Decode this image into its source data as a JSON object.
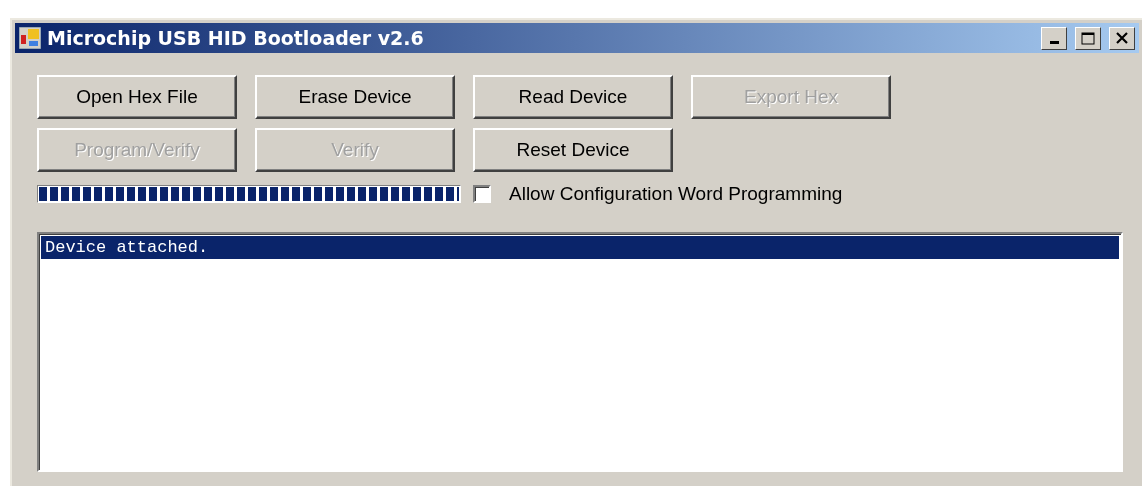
{
  "window": {
    "title": "Microchip USB HID Bootloader v2.6"
  },
  "buttons": [
    {
      "label": "Open Hex File",
      "disabled": false
    },
    {
      "label": "Erase Device",
      "disabled": false
    },
    {
      "label": "Read Device",
      "disabled": false
    },
    {
      "label": "Export Hex",
      "disabled": true
    },
    {
      "label": "Program/Verify",
      "disabled": true
    },
    {
      "label": "Verify",
      "disabled": true
    },
    {
      "label": "Reset Device",
      "disabled": false
    }
  ],
  "progress": {
    "level": 1
  },
  "config_checkbox": {
    "label": "Allow Configuration Word Programming",
    "checked": false
  },
  "log": {
    "lines": [
      {
        "text": "Device attached.",
        "selected": true
      }
    ]
  }
}
